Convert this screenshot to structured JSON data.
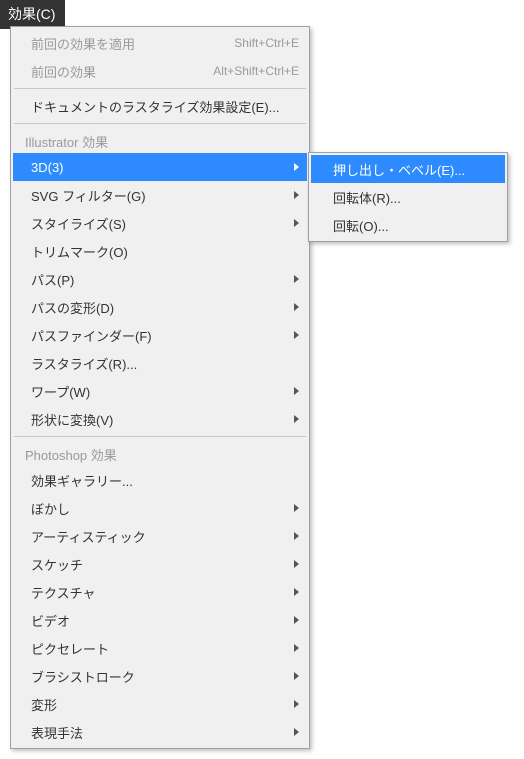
{
  "menuTitle": "効果(C)",
  "top": [
    {
      "label": "前回の効果を適用",
      "shortcut": "Shift+Ctrl+E",
      "disabled": true
    },
    {
      "label": "前回の効果",
      "shortcut": "Alt+Shift+Ctrl+E",
      "disabled": true
    }
  ],
  "rasterize": "ドキュメントのラスタライズ効果設定(E)...",
  "illustratorHeader": "Illustrator 効果",
  "illustratorItems": [
    {
      "label": "3D(3)",
      "arrow": true,
      "selected": true
    },
    {
      "label": "SVG フィルター(G)",
      "arrow": true
    },
    {
      "label": "スタイライズ(S)",
      "arrow": true
    },
    {
      "label": "トリムマーク(O)"
    },
    {
      "label": "パス(P)",
      "arrow": true
    },
    {
      "label": "パスの変形(D)",
      "arrow": true
    },
    {
      "label": "パスファインダー(F)",
      "arrow": true
    },
    {
      "label": "ラスタライズ(R)..."
    },
    {
      "label": "ワープ(W)",
      "arrow": true
    },
    {
      "label": "形状に変換(V)",
      "arrow": true
    }
  ],
  "photoshopHeader": "Photoshop 効果",
  "photoshopItems": [
    {
      "label": "効果ギャラリー..."
    },
    {
      "label": "ぼかし",
      "arrow": true
    },
    {
      "label": "アーティスティック",
      "arrow": true
    },
    {
      "label": "スケッチ",
      "arrow": true
    },
    {
      "label": "テクスチャ",
      "arrow": true
    },
    {
      "label": "ビデオ",
      "arrow": true
    },
    {
      "label": "ピクセレート",
      "arrow": true
    },
    {
      "label": "ブラシストローク",
      "arrow": true
    },
    {
      "label": "変形",
      "arrow": true
    },
    {
      "label": "表現手法",
      "arrow": true
    }
  ],
  "submenu": [
    {
      "label": "押し出し・ベベル(E)...",
      "selected": true
    },
    {
      "label": "回転体(R)..."
    },
    {
      "label": "回転(O)..."
    }
  ]
}
